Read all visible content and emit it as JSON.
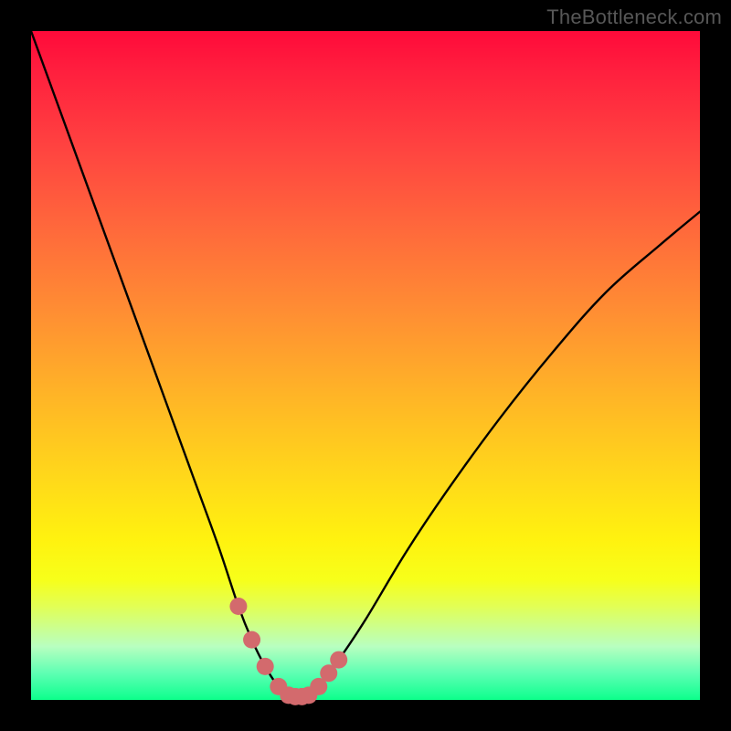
{
  "watermark": "TheBottleneck.com",
  "colors": {
    "page_bg": "#000000",
    "curve_stroke": "#000000",
    "marker_fill": "#d36a6d",
    "gradient_top": "#ff0a3a",
    "gradient_mid": "#fff20f",
    "gradient_bottom": "#0cff8a"
  },
  "chart_data": {
    "type": "line",
    "title": "",
    "xlabel": "",
    "ylabel": "",
    "xlim": [
      0,
      100
    ],
    "ylim": [
      0,
      100
    ],
    "grid": false,
    "legend": false,
    "x": [
      0,
      4,
      8,
      12,
      16,
      20,
      24,
      28,
      31,
      33,
      35,
      37,
      39,
      41,
      43,
      46,
      50,
      56,
      62,
      70,
      78,
      86,
      94,
      100
    ],
    "values": [
      100,
      89,
      78,
      67,
      56,
      45,
      34,
      23,
      14,
      9,
      5,
      2,
      0.5,
      0.5,
      2,
      6,
      12,
      22,
      31,
      42,
      52,
      61,
      68,
      73
    ],
    "series": [
      {
        "name": "bottleneck-curve",
        "x": [
          0,
          4,
          8,
          12,
          16,
          20,
          24,
          28,
          31,
          33,
          35,
          37,
          39,
          41,
          43,
          46,
          50,
          56,
          62,
          70,
          78,
          86,
          94,
          100
        ],
        "values": [
          100,
          89,
          78,
          67,
          56,
          45,
          34,
          23,
          14,
          9,
          5,
          2,
          0.5,
          0.5,
          2,
          6,
          12,
          22,
          31,
          42,
          52,
          61,
          68,
          73
        ]
      }
    ],
    "markers": {
      "name": "highlight-points",
      "x": [
        31,
        33,
        35,
        37,
        38.5,
        39.5,
        40.5,
        41.5,
        43,
        44.5,
        46
      ],
      "values": [
        14,
        9,
        5,
        2,
        0.7,
        0.5,
        0.5,
        0.7,
        2,
        4,
        6
      ]
    }
  }
}
